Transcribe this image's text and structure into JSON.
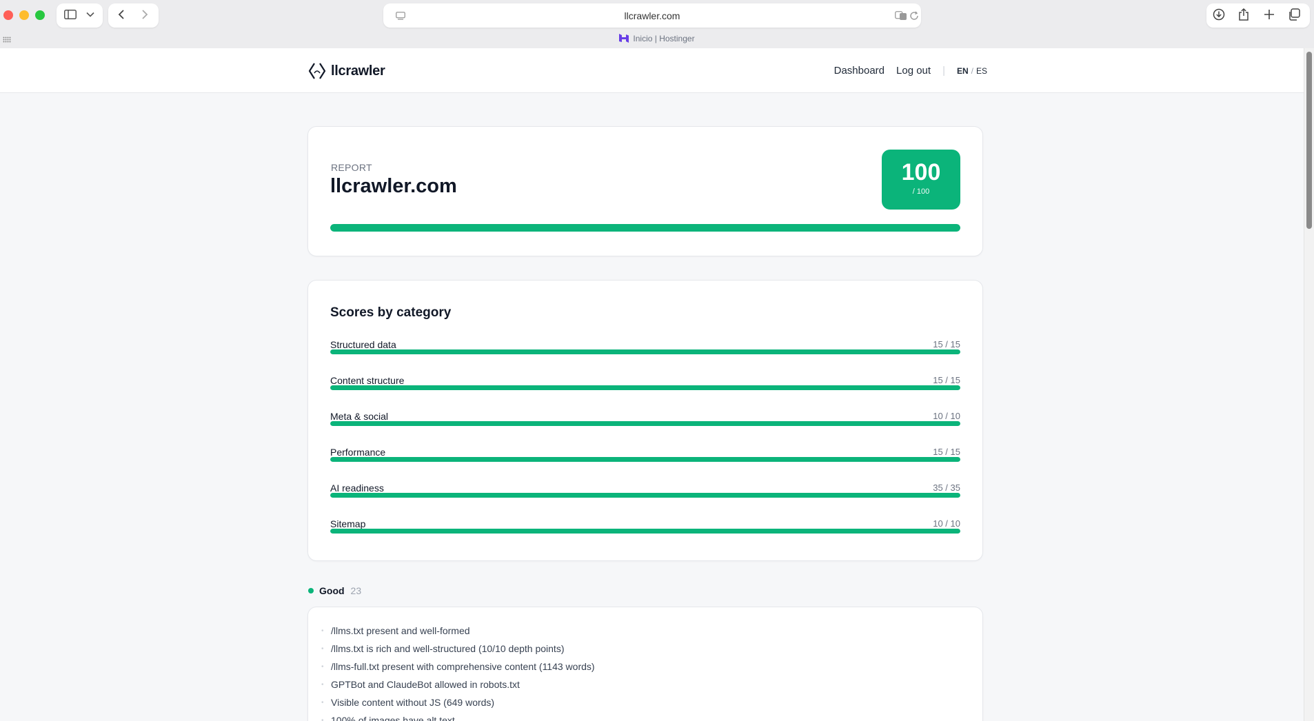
{
  "browser": {
    "url": "llcrawler.com",
    "tab_title": "Inicio | Hostinger"
  },
  "header": {
    "logo_text": "llcrawler",
    "nav": {
      "dashboard": "Dashboard",
      "logout": "Log out",
      "separator": "|",
      "lang_en": "EN",
      "lang_slash": "/",
      "lang_es": "ES"
    }
  },
  "report": {
    "eyebrow": "REPORT",
    "domain": "llcrawler.com",
    "score": "100",
    "score_max": "/ 100",
    "score_fraction": 1.0
  },
  "categories": {
    "heading": "Scores by category",
    "items": [
      {
        "label": "Structured data",
        "score": "15 / 15",
        "fraction": 1.0
      },
      {
        "label": "Content structure",
        "score": "15 / 15",
        "fraction": 1.0
      },
      {
        "label": "Meta & social",
        "score": "10 / 10",
        "fraction": 1.0
      },
      {
        "label": "Performance",
        "score": "15 / 15",
        "fraction": 1.0
      },
      {
        "label": "AI readiness",
        "score": "35 / 35",
        "fraction": 1.0
      },
      {
        "label": "Sitemap",
        "score": "10 / 10",
        "fraction": 1.0
      }
    ]
  },
  "good": {
    "label": "Good",
    "count": "23",
    "items": [
      "/llms.txt present and well-formed",
      "/llms.txt is rich and well-structured (10/10 depth points)",
      "/llms-full.txt present with comprehensive content (1143 words)",
      "GPTBot and ClaudeBot allowed in robots.txt",
      "Visible content without JS (649 words)",
      "100% of images have alt text"
    ]
  },
  "colors": {
    "accent_green": "#0bb47a",
    "active_lang": "#4f46e5"
  }
}
